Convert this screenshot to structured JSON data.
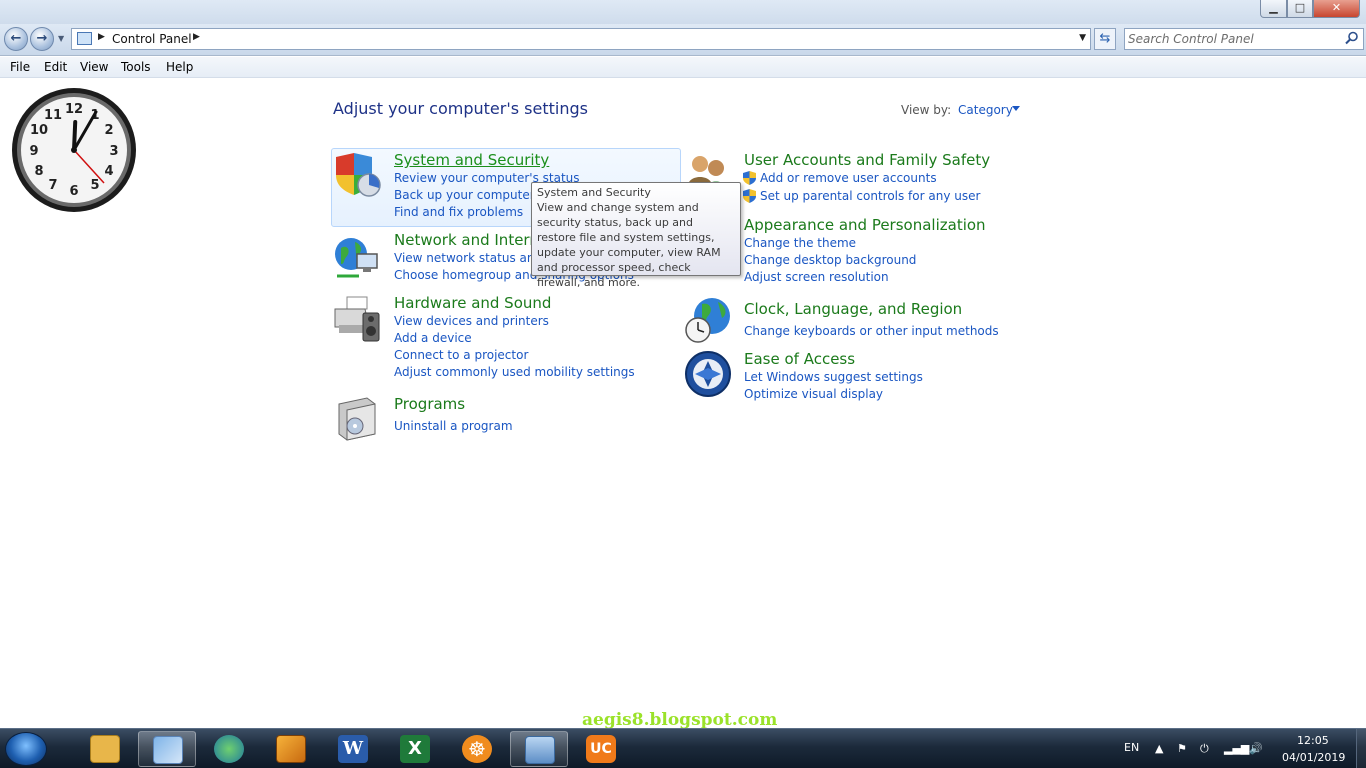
{
  "window": {
    "minimize_glyph": "▁",
    "maximize_glyph": "□",
    "close_glyph": "✕"
  },
  "nav": {
    "back_glyph": "←",
    "forward_glyph": "→",
    "breadcrumb": [
      "Control Panel"
    ],
    "search_placeholder": "Search Control Panel",
    "refresh_glyph": "⇆"
  },
  "menu": [
    "File",
    "Edit",
    "View",
    "Tools",
    "Help"
  ],
  "clock": {
    "numerals": [
      "12",
      "1",
      "2",
      "3",
      "4",
      "5",
      "6",
      "7",
      "8",
      "9",
      "10",
      "11"
    ],
    "time": "12:05"
  },
  "main": {
    "title": "Adjust your computer's settings",
    "view_by_label": "View by:",
    "view_by_value": "Category"
  },
  "categories": {
    "security": {
      "title": "System and Security",
      "icon": "shield-chart-icon",
      "links": [
        "Review your computer's status",
        "Back up your computer",
        "Find and fix problems"
      ]
    },
    "network": {
      "title": "Network and Internet",
      "icon": "globe-network-icon",
      "links": [
        "View network status and tasks",
        "Choose homegroup and sharing options"
      ]
    },
    "hardware": {
      "title": "Hardware and Sound",
      "icon": "printer-speaker-icon",
      "links": [
        "View devices and printers",
        "Add a device",
        "Connect to a projector",
        "Adjust commonly used mobility settings"
      ]
    },
    "programs": {
      "title": "Programs",
      "icon": "programs-box-icon",
      "links": [
        "Uninstall a program"
      ]
    },
    "users": {
      "title": "User Accounts and Family Safety",
      "icon": "users-icon",
      "links": [
        "Add or remove user accounts",
        "Set up parental controls for any user"
      ]
    },
    "appearance": {
      "title": "Appearance and Personalization",
      "links": [
        "Change the theme",
        "Change desktop background",
        "Adjust screen resolution"
      ]
    },
    "clock": {
      "title": "Clock, Language, and Region",
      "icon": "globe-clock-icon",
      "links": [
        "Change keyboards or other input methods"
      ]
    },
    "ease": {
      "title": "Ease of Access",
      "icon": "ease-of-access-icon",
      "links": [
        "Let Windows suggest settings",
        "Optimize visual display"
      ]
    }
  },
  "tooltip": {
    "title": "System and Security",
    "body": "View and change system and security status, back up and restore file and system settings, update your computer, view RAM and processor speed, check firewall, and more."
  },
  "watermark": "aegis8.blogspot.com",
  "taskbar": {
    "items": [
      "explorer-folder-icon",
      "control-panel-icon",
      "download-manager-icon",
      "winamp-icon",
      "word-icon",
      "excel-icon",
      "helm-app-icon",
      "gadgets-icon",
      "uc-browser-icon"
    ],
    "colors": {
      "explorer": "#e8b64a",
      "word": "#2a5caa",
      "excel": "#1f7a3a",
      "uc": "#f07a1a",
      "helm": "#f08c1e"
    },
    "tray": {
      "lang": "EN",
      "time": "12:05",
      "date": "04/01/2019"
    }
  }
}
